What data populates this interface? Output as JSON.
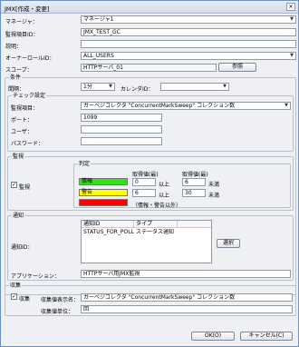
{
  "window": {
    "title": "JMX[作成・変更]",
    "close": "×"
  },
  "manager": {
    "label": "マネージャ：",
    "value": "マネージャ1"
  },
  "monitor_id": {
    "label": "監視項目ID：",
    "value": "JMX_TEST_GC"
  },
  "description": {
    "label": "説明：",
    "value": ""
  },
  "owner_role": {
    "label": "オーナーロールID：",
    "value": "ALL_USERS"
  },
  "scope": {
    "label": "スコープ：",
    "value": "HTTPサーバ_01",
    "button": "参照"
  },
  "condition": {
    "group": "条件",
    "interval_label": "間隔：",
    "interval_value": "1分",
    "calendar_label": "カレンダID：",
    "calendar_value": ""
  },
  "check": {
    "group": "チェック設定",
    "item_label": "監視項目：",
    "item_value": "ガーベジコレクタ \"ConcurrentMarkSweep\" コレクション数",
    "port_label": "ポート：",
    "port_value": "1099",
    "user_label": "ユーザ：",
    "user_value": "",
    "password_label": "パスワード：",
    "password_value": ""
  },
  "monitor": {
    "group": "監視",
    "checkbox_label": "監視",
    "judgement_group": "判定",
    "min_header": "取得値(最)",
    "max_header": "取得値(最)",
    "info_label": "情報",
    "info_min": "0",
    "info_max": "6",
    "warn_label": "警告",
    "warn_min": "6",
    "warn_max": "30",
    "above": "以上",
    "below": "未満",
    "critical_note": "（情報・警告以外）",
    "colors": {
      "info": "#33e01a",
      "warning": "#ffff00",
      "critical": "#ff0000"
    }
  },
  "notify": {
    "group": "通知",
    "id_label": "通知ID：",
    "col_id": "通知ID",
    "col_type": "タイプ",
    "rows": [
      {
        "id": "STATUS_FOR_POLLI",
        "type": "ステータス通知"
      }
    ],
    "select_button": "選択",
    "app_label": "アプリケーション：",
    "app_value": "HTTPサーバ用JMX監視"
  },
  "collect": {
    "group": "収集",
    "checkbox_label": "収集",
    "display_name_label": "収集値表示名：",
    "display_name_value": "ガーベジコレクタ \"ConcurrentMarkSweep\" コレクション数",
    "unit_label": "収集値単位：",
    "unit_value": "回"
  },
  "buttons": {
    "ok": "OK(O)",
    "cancel": "キャンセル(C)"
  }
}
